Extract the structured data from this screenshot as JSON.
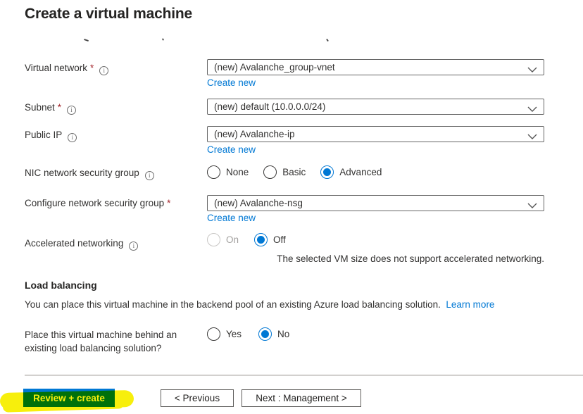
{
  "title": "Create a virtual machine",
  "required_marker": "*",
  "icons": {
    "info_glyph": "i"
  },
  "fields": {
    "virtual_network": {
      "label": "Virtual network",
      "value": "(new) Avalanche_group-vnet",
      "create_new": "Create new"
    },
    "subnet": {
      "label": "Subnet",
      "value": "(new) default (10.0.0.0/24)"
    },
    "public_ip": {
      "label": "Public IP",
      "value": "(new) Avalanche-ip",
      "create_new": "Create new"
    },
    "nic_nsg": {
      "label": "NIC network security group",
      "options": [
        "None",
        "Basic",
        "Advanced"
      ],
      "selected": "Advanced"
    },
    "configure_nsg": {
      "label": "Configure network security group",
      "value": "(new) Avalanche-nsg",
      "create_new": "Create new"
    },
    "accelerated_networking": {
      "label": "Accelerated networking",
      "options": [
        "On",
        "Off"
      ],
      "selected": "Off",
      "disabled_option": "On",
      "note": "The selected VM size does not support accelerated networking."
    }
  },
  "load_balancing": {
    "heading": "Load balancing",
    "description": "You can place this virtual machine in the backend pool of an existing Azure load balancing solution.",
    "learn_more": "Learn more",
    "question_line1": "Place this virtual machine behind an",
    "question_line2": "existing load balancing solution?",
    "options": [
      "Yes",
      "No"
    ],
    "selected": "No"
  },
  "footer": {
    "review_create_label": "Review + create",
    "previous_label": "< Previous",
    "next_label": "Next : Management >"
  },
  "colors": {
    "accent": "#0078d4",
    "link": "#0078d4",
    "required": "#a4262c",
    "primary_button": "#0078d4",
    "highlighter": "#f7ef0c"
  }
}
